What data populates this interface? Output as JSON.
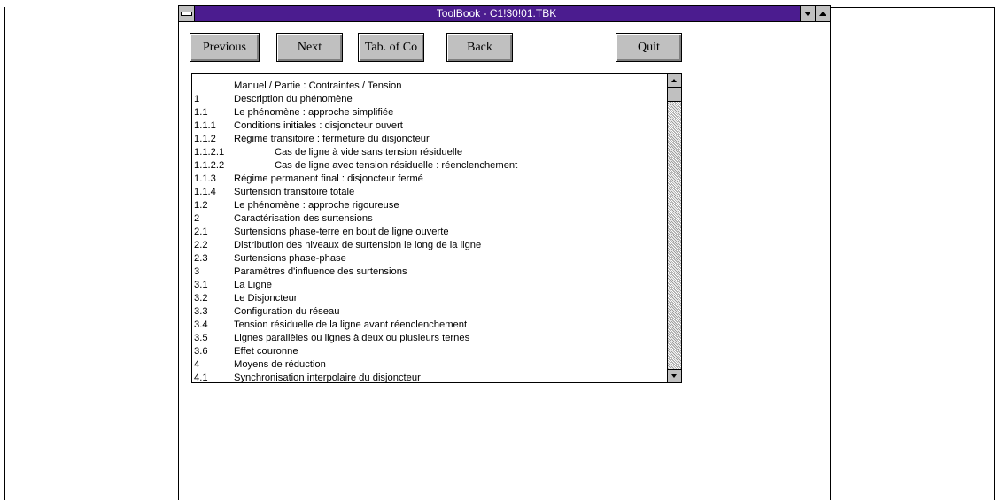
{
  "window": {
    "title": "ToolBook - C1!30!01.TBK"
  },
  "buttons": {
    "previous": "Previous",
    "next": "Next",
    "toc": "Tab. of Co",
    "back": "Back",
    "quit": "Quit"
  },
  "toc_list": {
    "items": [
      {
        "num": "",
        "text": "Manuel / Partie : Contraintes / Tension"
      },
      {
        "num": "1",
        "text": "Description du phénomène"
      },
      {
        "num": "1.1",
        "text": "Le phénomène : approche simplifiée"
      },
      {
        "num": "1.1.1",
        "text": "Conditions initiales : disjoncteur ouvert"
      },
      {
        "num": "1.1.2",
        "text": "Régime transitoire : fermeture du disjoncteur"
      },
      {
        "num": "1.1.2.1",
        "text": "Cas de ligne à vide sans tension résiduelle"
      },
      {
        "num": "1.1.2.2",
        "text": "Cas de ligne avec tension résiduelle : réenclenchement"
      },
      {
        "num": "1.1.3",
        "text": "Régime permanent final : disjoncteur fermé"
      },
      {
        "num": "1.1.4",
        "text": "Surtension transitoire totale"
      },
      {
        "num": "1.2",
        "text": "Le phénomène : approche rigoureuse"
      },
      {
        "num": "2",
        "text": "Caractérisation des surtensions"
      },
      {
        "num": "2.1",
        "text": "Surtensions phase-terre en bout de ligne ouverte"
      },
      {
        "num": "2.2",
        "text": "Distribution des niveaux de surtension le long de la ligne"
      },
      {
        "num": "2.3",
        "text": "Surtensions phase-phase"
      },
      {
        "num": "3",
        "text": "Paramètres d'influence des surtensions"
      },
      {
        "num": "3.1",
        "text": "La Ligne"
      },
      {
        "num": "3.2",
        "text": "Le Disjoncteur"
      },
      {
        "num": "3.3",
        "text": "Configuration du réseau"
      },
      {
        "num": "3.4",
        "text": "Tension résiduelle de la ligne avant réenclenchement"
      },
      {
        "num": "3.5",
        "text": "Lignes parallèles ou lignes à deux ou plusieurs ternes"
      },
      {
        "num": "3.6",
        "text": "Effet couronne"
      },
      {
        "num": "4",
        "text": "Moyens de réduction"
      },
      {
        "num": "4.1",
        "text": "Synchronisation interpolaire du disjoncteur"
      }
    ]
  },
  "colors": {
    "titlebar": "#4b1c8f",
    "button_face": "#c0c0c0"
  }
}
